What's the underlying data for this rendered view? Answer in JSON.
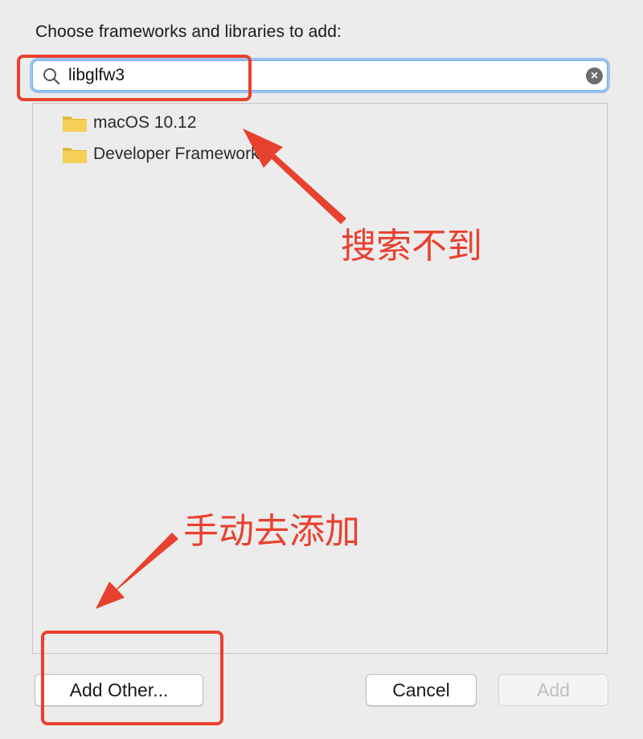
{
  "dialog": {
    "prompt": "Choose frameworks and libraries to add:"
  },
  "search": {
    "value": "libglfw3",
    "icon": "magnifier-icon",
    "clear_icon": "clear-icon",
    "clear_glyph": "×"
  },
  "list": {
    "items": [
      {
        "label": "macOS 10.12",
        "icon": "folder-icon"
      },
      {
        "label": "Developer Frameworks",
        "icon": "folder-icon"
      }
    ]
  },
  "buttons": {
    "add_other": "Add Other...",
    "cancel": "Cancel",
    "add": "Add"
  },
  "annotations": {
    "not_found": "搜索不到",
    "add_manually": "手动去添加",
    "color": "#e8412f"
  },
  "colors": {
    "window_bg": "#ececec",
    "focus_ring": "#9cc3f1",
    "folder_yellow": "#f5cf5a"
  }
}
